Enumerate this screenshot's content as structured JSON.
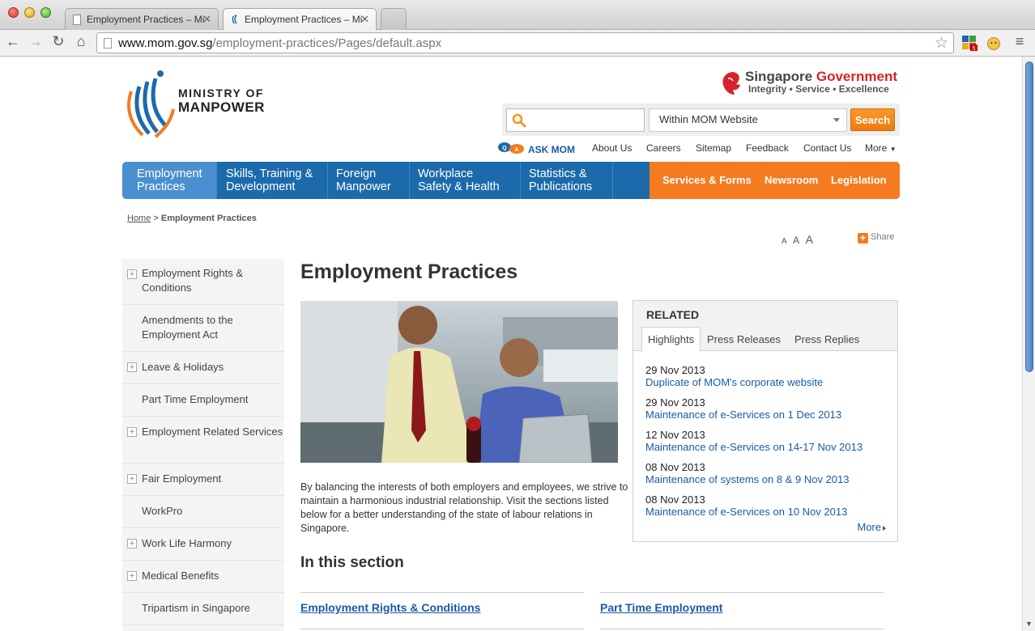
{
  "browser": {
    "tabs": [
      {
        "title": "Employment Practices – Mi"
      },
      {
        "title": "Employment Practices – Mi"
      }
    ],
    "url_host": "www.mom.gov.sg",
    "url_path": "/employment-practices/Pages/default.aspx",
    "extension_badge": "5"
  },
  "header": {
    "logo_line1": "MINISTRY OF",
    "logo_line2": "MANPOWER",
    "gov_singapore": "Singapore",
    "gov_government": "Government",
    "gov_tagline": "Integrity • Service • Excellence",
    "search_placeholder": "",
    "search_scope": "Within MOM Website",
    "search_button": "Search",
    "ask_mom": "ASK MOM",
    "utility_links": [
      "About Us",
      "Careers",
      "Sitemap",
      "Feedback",
      "Contact Us",
      "More"
    ]
  },
  "nav": {
    "items": [
      {
        "line1": "Employment",
        "line2": "Practices"
      },
      {
        "line1": "Skills, Training &",
        "line2": "Development"
      },
      {
        "line1": "Foreign",
        "line2": "Manpower"
      },
      {
        "line1": "Workplace",
        "line2": "Safety & Health"
      },
      {
        "line1": "Statistics &",
        "line2": "Publications"
      }
    ],
    "orange_items": [
      "Services & Forms",
      "Newsroom",
      "Legislation"
    ]
  },
  "breadcrumb": {
    "home": "Home",
    "separator": ">",
    "current": "Employment Practices"
  },
  "tools": {
    "size_small": "A",
    "size_medium": "A",
    "size_large": "A",
    "share": "Share"
  },
  "sidebar": {
    "items": [
      {
        "label": "Employment Rights & Conditions",
        "expandable": true
      },
      {
        "label": "Amendments to the Employment Act",
        "expandable": false
      },
      {
        "label": "Leave & Holidays",
        "expandable": true
      },
      {
        "label": "Part Time Employment",
        "expandable": false
      },
      {
        "label": "Employment Related Services",
        "expandable": true
      },
      {
        "label": "Fair Employment",
        "expandable": true
      },
      {
        "label": "WorkPro",
        "expandable": false
      },
      {
        "label": "Work Life Harmony",
        "expandable": true
      },
      {
        "label": "Medical Benefits",
        "expandable": true
      },
      {
        "label": "Tripartism in Singapore",
        "expandable": false
      }
    ]
  },
  "main": {
    "title": "Employment Practices",
    "intro": "By balancing the interests of both employers and employees, we strive to maintain a harmonious industrial relationship. Visit the sections listed below for a better understanding of the state of labour relations in Singapore.",
    "section_title": "In this section",
    "section_links": [
      "Employment Rights & Conditions",
      "Part Time Employment"
    ]
  },
  "related": {
    "title": "RELATED",
    "tabs": [
      "Highlights",
      "Press Releases",
      "Press Replies"
    ],
    "items": [
      {
        "date": "29 Nov 2013",
        "headline": "Duplicate of MOM's corporate website"
      },
      {
        "date": "29 Nov 2013",
        "headline": "Maintenance of e-Services on 1 Dec 2013"
      },
      {
        "date": "12 Nov 2013",
        "headline": "Maintenance of e-Services on 14-17 Nov 2013"
      },
      {
        "date": "08 Nov 2013",
        "headline": "Maintenance of systems on 8 & 9 Nov 2013"
      },
      {
        "date": "08 Nov 2013",
        "headline": "Maintenance of e-Services on 10 Nov 2013"
      }
    ],
    "more": "More"
  },
  "colors": {
    "nav_blue": "#1c6aac",
    "nav_active": "#4a90d0",
    "accent_orange": "#f47b20",
    "link_blue": "#1b5aa3"
  }
}
